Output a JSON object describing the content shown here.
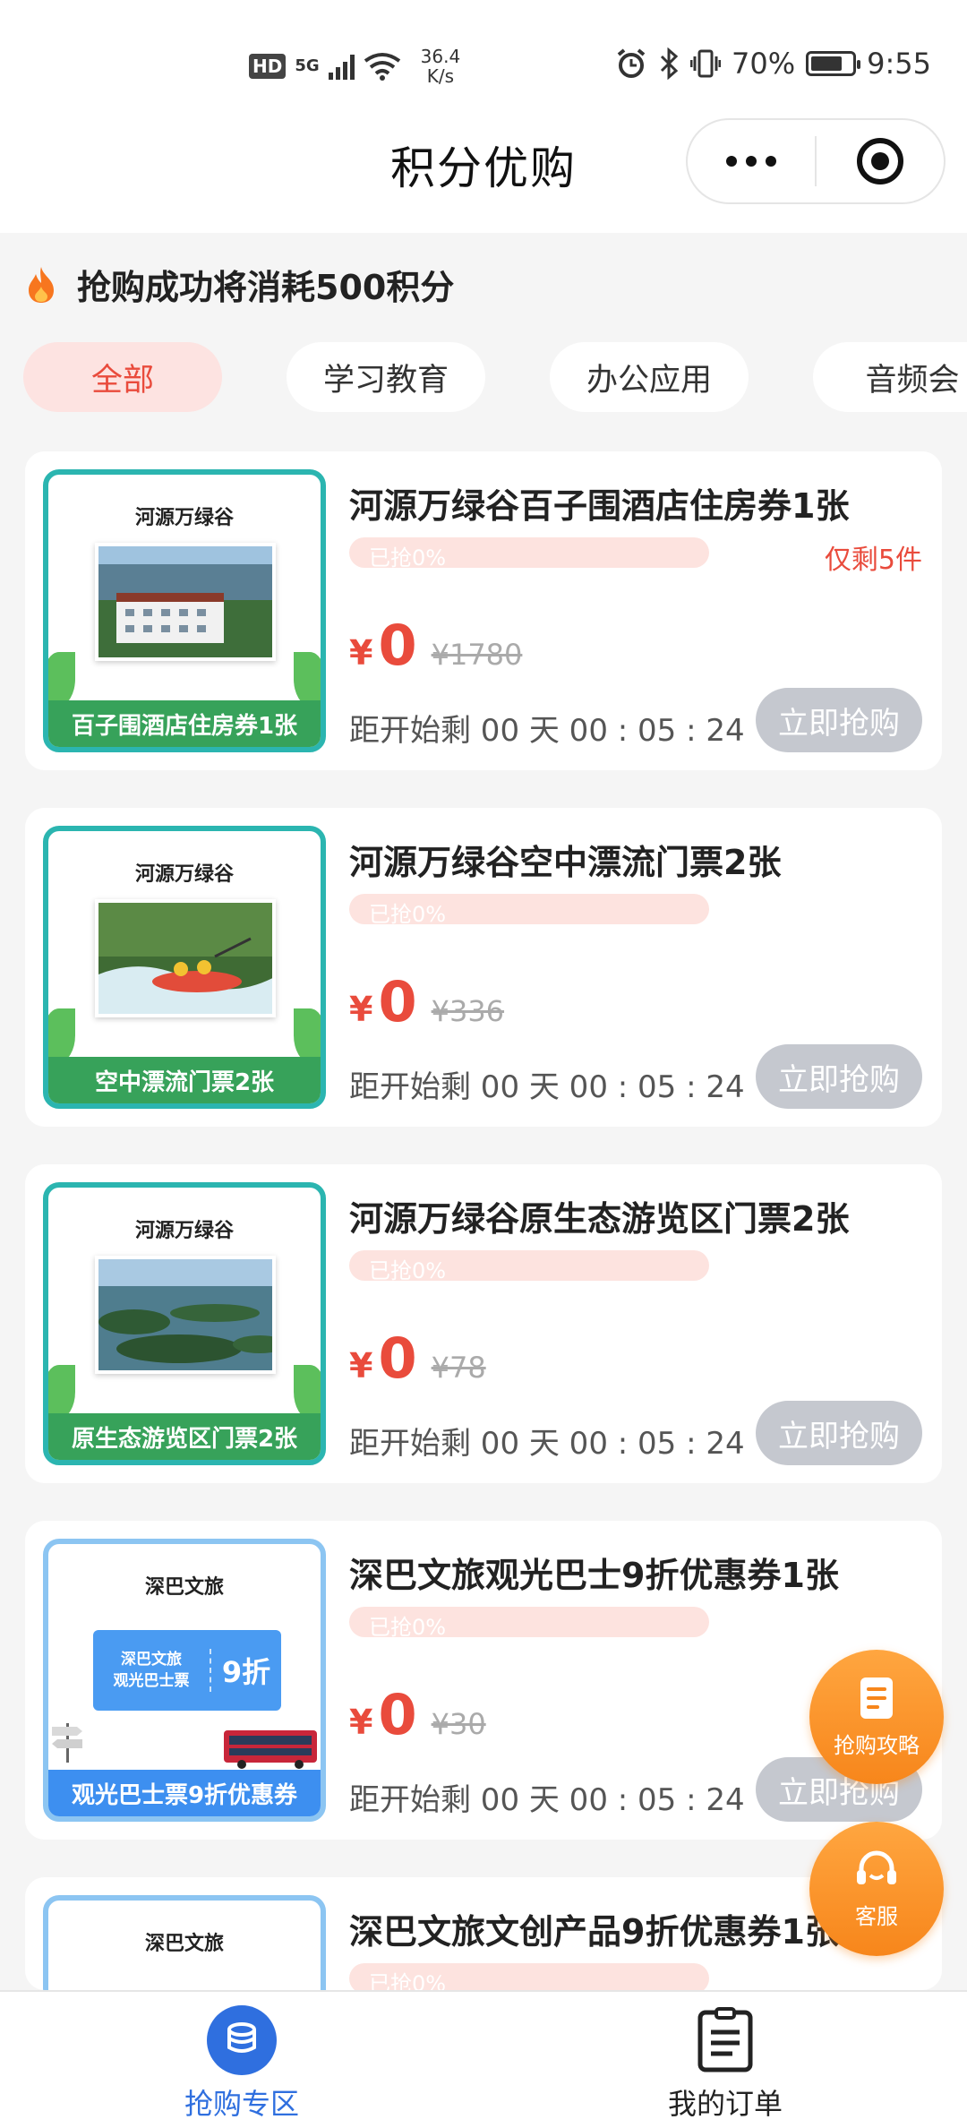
{
  "status_bar": {
    "hd": "HD",
    "network": "5G",
    "speed_value": "36.4",
    "speed_unit": "K/s",
    "battery": "70%",
    "time": "9:55"
  },
  "header": {
    "title": "积分优购"
  },
  "notice": {
    "text": "抢购成功将消耗500积分"
  },
  "tabs": [
    "全部",
    "学习教育",
    "办公应用",
    "音频会"
  ],
  "products": [
    {
      "title": "河源万绿谷百子围酒店住房券1张",
      "thumb_brand": "河源万绿谷",
      "thumb_caption": "百子围酒店住房券1张",
      "progress_text": "已抢0%",
      "progress": 0,
      "remain": "仅剩5件",
      "price_symbol": "¥",
      "price": "0",
      "original_price": "¥1780",
      "countdown": "距开始剩 00 天 00 : 05 : 24",
      "button": "立即抢购"
    },
    {
      "title": "河源万绿谷空中漂流门票2张",
      "thumb_brand": "河源万绿谷",
      "thumb_caption": "空中漂流门票2张",
      "progress_text": "已抢0%",
      "progress": 0,
      "price_symbol": "¥",
      "price": "0",
      "original_price": "¥336",
      "countdown": "距开始剩 00 天 00 : 05 : 24",
      "button": "立即抢购"
    },
    {
      "title": "河源万绿谷原生态游览区门票2张",
      "thumb_brand": "河源万绿谷",
      "thumb_caption": "原生态游览区门票2张",
      "progress_text": "已抢0%",
      "progress": 0,
      "price_symbol": "¥",
      "price": "0",
      "original_price": "¥78",
      "countdown": "距开始剩 00 天 00 : 05 : 24",
      "button": "立即抢购"
    },
    {
      "title": "深巴文旅观光巴士9折优惠券1张",
      "thumb_brand": "深巴文旅",
      "thumb_ticket_line1": "深巴文旅",
      "thumb_ticket_line2": "观光巴士票",
      "thumb_ticket_discount": "9折",
      "thumb_caption": "观光巴士票9折优惠券",
      "progress_text": "已抢0%",
      "progress": 0,
      "price_symbol": "¥",
      "price": "0",
      "original_price": "¥30",
      "countdown": "距开始剩 00 天 00 : 05 : 24",
      "button": "立即抢购"
    },
    {
      "title": "深巴文旅文创产品9折优惠券1张",
      "thumb_brand": "深巴文旅",
      "progress_text": "已抢0%",
      "progress": 0
    }
  ],
  "fabs": {
    "guide_label": "抢购攻略",
    "service_label": "客服"
  },
  "bottom_nav": [
    {
      "label": "抢购专区",
      "active": true
    },
    {
      "label": "我的订单",
      "active": false
    }
  ],
  "colors": {
    "accent": "#e94b3c",
    "tab_active_bg": "#fde3e1",
    "button_disabled": "#c5c8cf",
    "fab_orange": "#f7861b",
    "nav_active": "#2f6fdf"
  }
}
